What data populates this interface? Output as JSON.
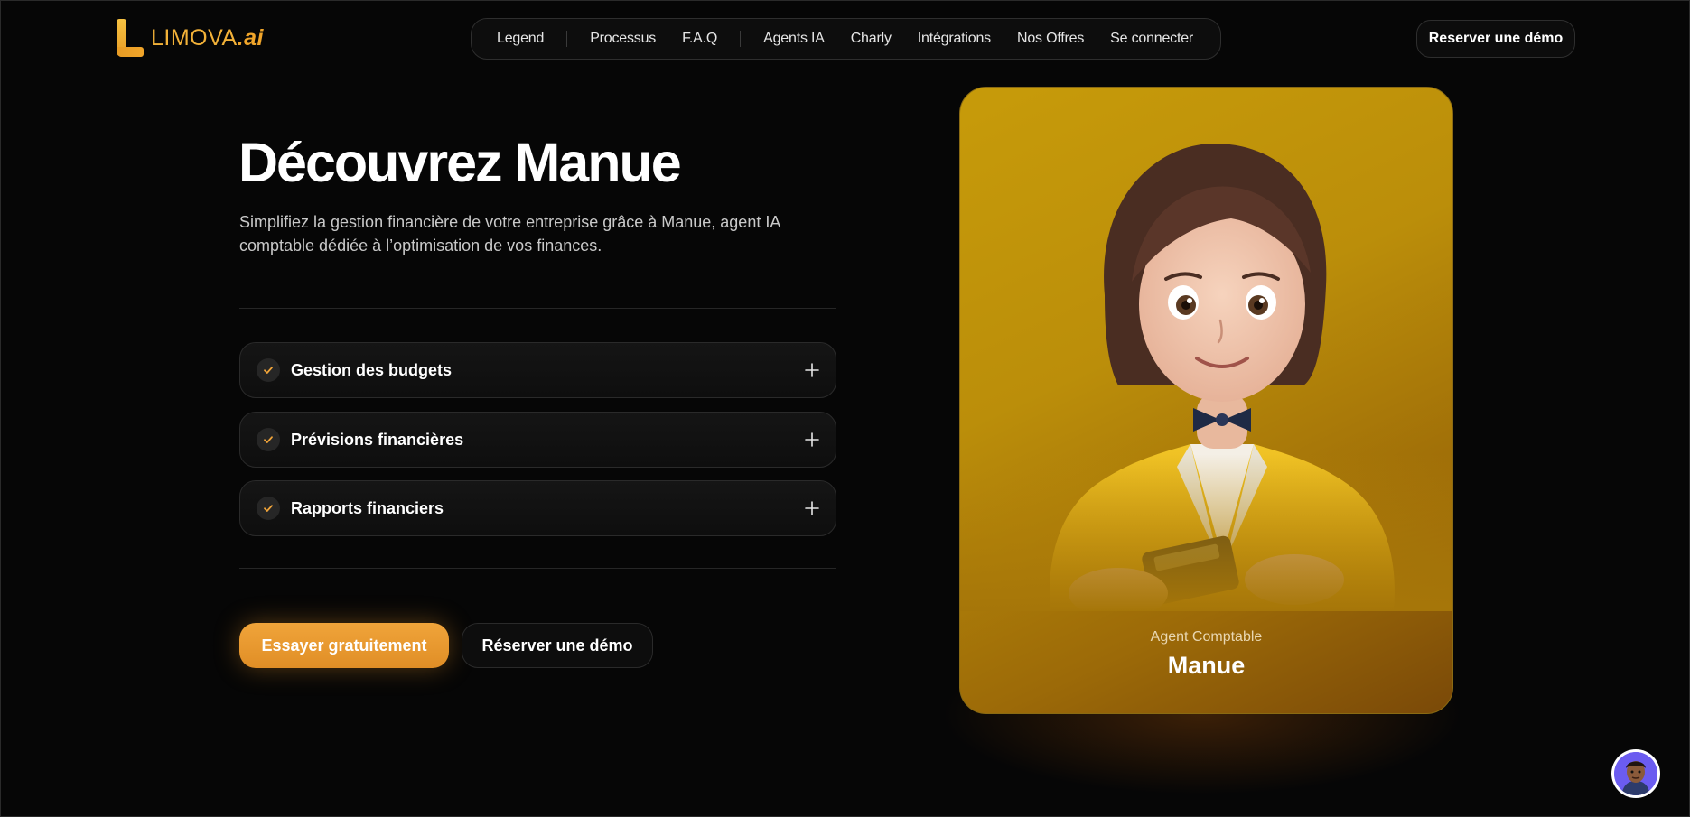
{
  "logo": {
    "name": "LIMOVA",
    "suffix": ".ai"
  },
  "nav": {
    "items": [
      "Legend",
      "Processus",
      "F.A.Q",
      "Agents IA",
      "Charly",
      "Intégrations",
      "Nos Offres",
      "Se connecter"
    ]
  },
  "header": {
    "demo_button": "Reserver une démo"
  },
  "hero": {
    "title": "Découvrez Manue",
    "subtitle": "Simplifiez la gestion financière de votre entreprise grâce à Manue, agent IA comptable dédiée à l’optimisation de vos finances."
  },
  "features": [
    {
      "label": "Gestion des budgets"
    },
    {
      "label": "Prévisions financières"
    },
    {
      "label": "Rapports financiers"
    }
  ],
  "cta": {
    "primary": "Essayer gratuitement",
    "secondary": "Réserver une démo"
  },
  "agent_card": {
    "role": "Agent Comptable",
    "name": "Manue"
  },
  "colors": {
    "accent": "#f0a43a",
    "card": "#c79b0a",
    "background": "#060606"
  },
  "icons": {
    "feature_check": "check-icon",
    "feature_expand": "plus-icon",
    "chat": "chat-avatar-icon"
  }
}
